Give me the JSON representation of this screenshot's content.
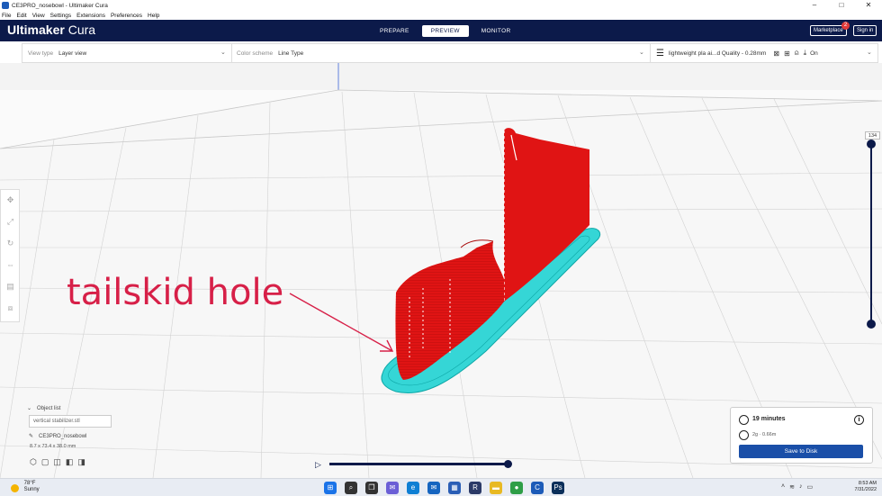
{
  "window": {
    "title": "CE3PRO_nosebowl - Ultimaker Cura",
    "controls": [
      "–",
      "□",
      "✕"
    ]
  },
  "menu": [
    "File",
    "Edit",
    "View",
    "Settings",
    "Extensions",
    "Preferences",
    "Help"
  ],
  "header": {
    "logo_bold": "Ultimaker",
    "logo_light": " Cura",
    "tabs": [
      "PREPARE",
      "PREVIEW",
      "MONITOR"
    ],
    "active_tab": "PREVIEW",
    "marketplace_label": "Marketplace",
    "marketplace_badge": "2",
    "signin_label": "Sign in"
  },
  "toolbar": {
    "view_type_label": "View type",
    "view_type_value": "Layer view",
    "color_scheme_label": "Color scheme",
    "color_scheme_value": "Line Type",
    "profile_text": "lightweight pla ai...d Quality - 0.28mm",
    "support_value": "On"
  },
  "annotation": "tailskid hole",
  "layer_slider": {
    "max_label": "134",
    "upper_level": 1.0,
    "lower_level": 0.0
  },
  "object_list": {
    "header": "Object list",
    "file": "vertical stabilizer.stl",
    "project": "CE3PRO_nosebowl",
    "dimensions": "8.7 x 73.4 x 38.0 mm"
  },
  "print_info": {
    "time": "19 minutes",
    "material": "2g · 0.66m",
    "save_label": "Save to Disk"
  },
  "playback": {
    "progress": 1.0
  },
  "taskbar": {
    "temp": "78°F",
    "weather": "Sunny",
    "time": "8:53 AM",
    "date": "7/31/2022",
    "apps": [
      {
        "icon": "start-icon",
        "glyph": "⊞",
        "color": "#1a73e8"
      },
      {
        "icon": "search-icon",
        "glyph": "⌕",
        "color": "#333"
      },
      {
        "icon": "task-view-icon",
        "glyph": "❐",
        "color": "#333"
      },
      {
        "icon": "chat-icon",
        "glyph": "✉",
        "color": "#6b5fd6"
      },
      {
        "icon": "edge-icon",
        "glyph": "e",
        "color": "#0e7fd4"
      },
      {
        "icon": "mail-icon",
        "glyph": "✉",
        "color": "#1565c0"
      },
      {
        "icon": "store-icon",
        "glyph": "▦",
        "color": "#2a5eb6"
      },
      {
        "icon": "reader-icon",
        "glyph": "R",
        "color": "#2b3a67"
      },
      {
        "icon": "explorer-icon",
        "glyph": "▬",
        "color": "#e8b923"
      },
      {
        "icon": "chrome-icon",
        "glyph": "●",
        "color": "#2e9e47"
      },
      {
        "icon": "cura-icon",
        "glyph": "C",
        "color": "#1c5bb8"
      },
      {
        "icon": "photoshop-icon",
        "glyph": "Ps",
        "color": "#0b2f5a"
      }
    ]
  }
}
